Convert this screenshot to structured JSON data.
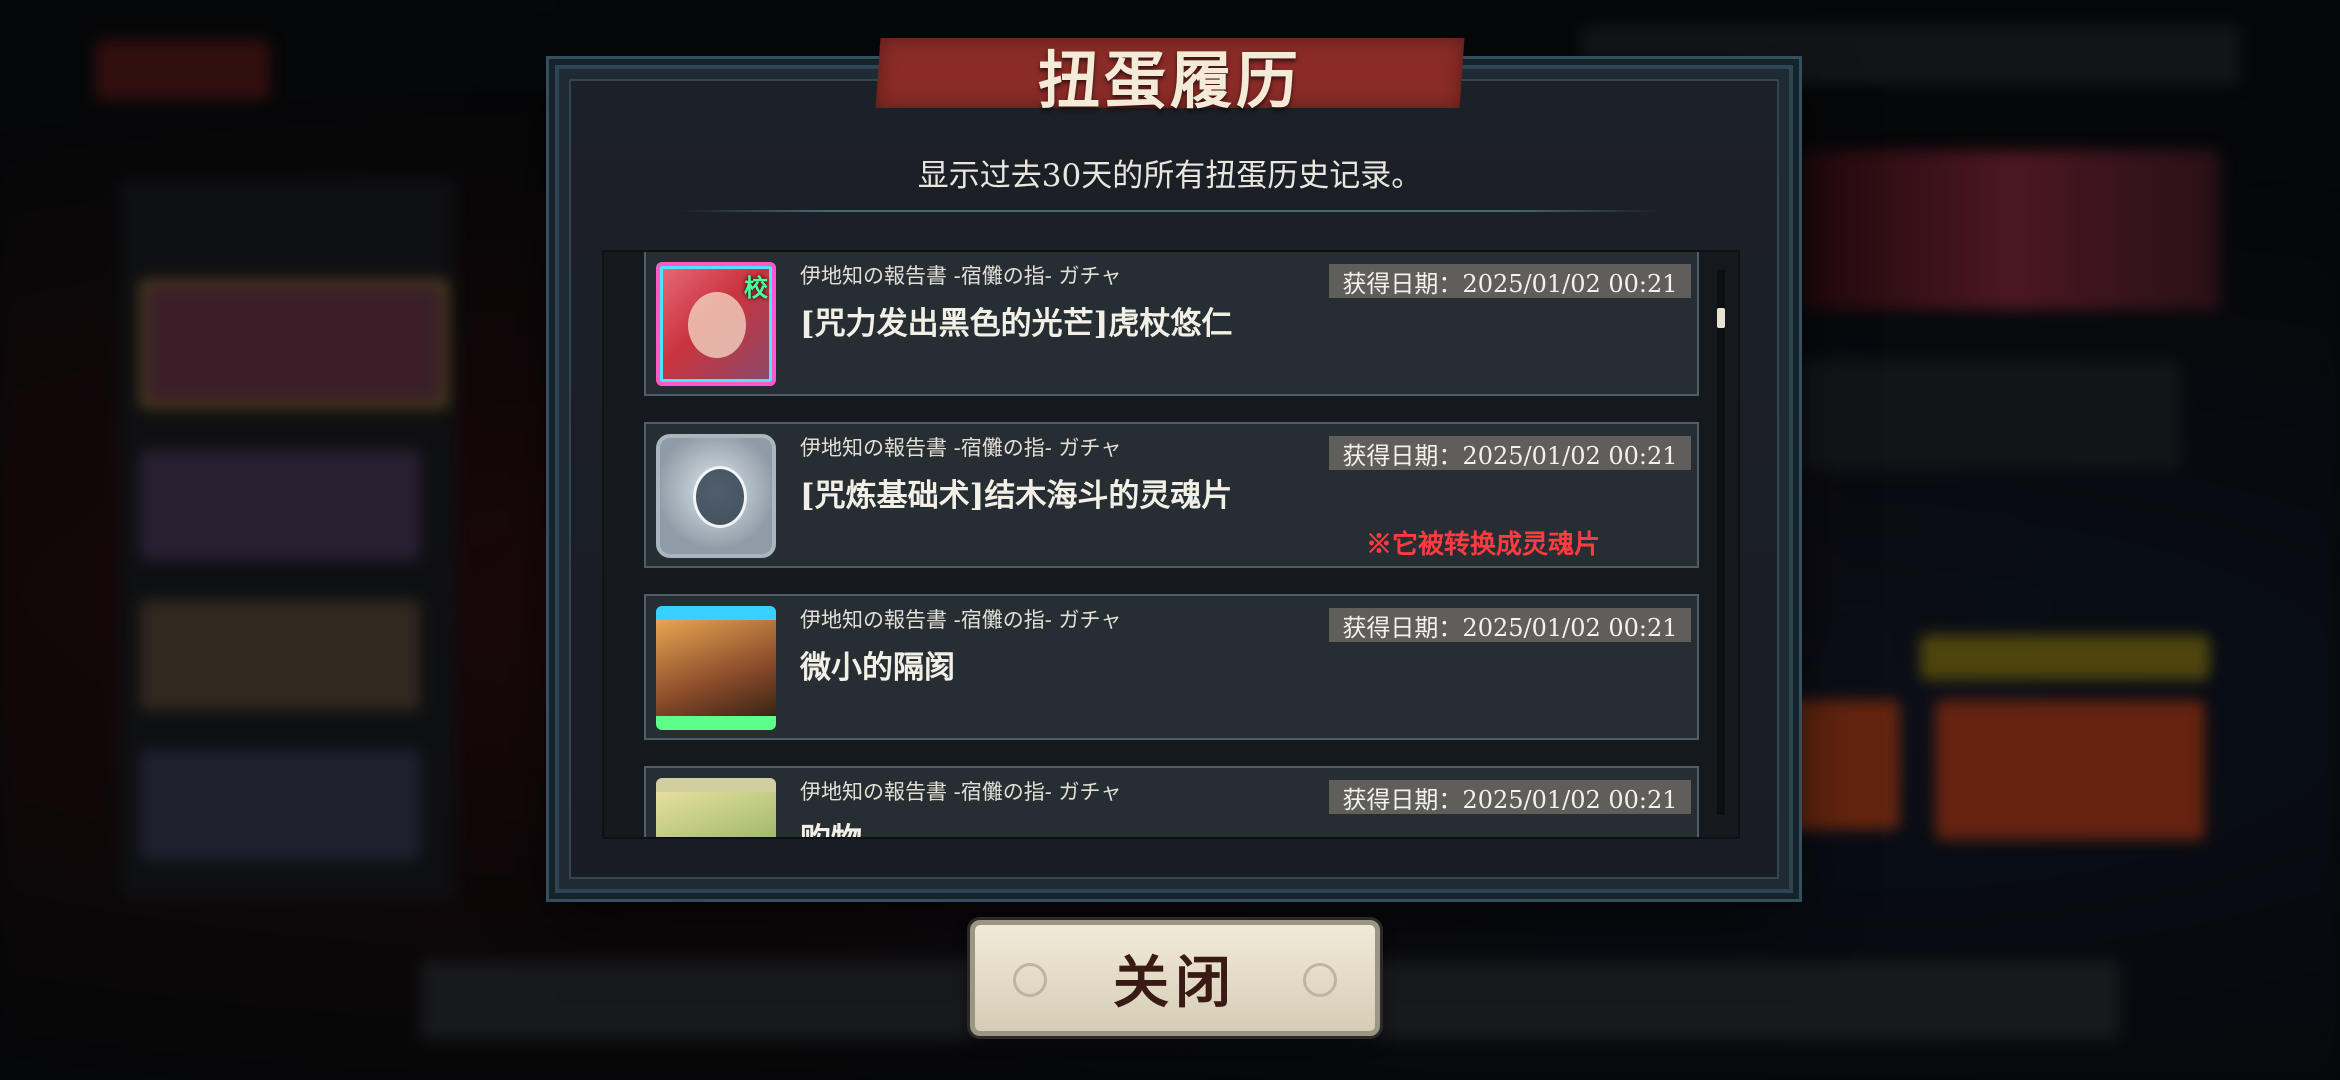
{
  "dialog": {
    "title": "扭蛋履历",
    "subtitle": "显示过去30天的所有扭蛋历史记录。",
    "close_label": "关闭"
  },
  "history": [
    {
      "source": "伊地知の報告書 -宿儺の指- ガチャ",
      "name": "[咒力发出黑色的光芒]虎杖悠仁",
      "date": "获得日期：2025/01/02 00:21",
      "grade": "校",
      "note": ""
    },
    {
      "source": "伊地知の報告書 -宿儺の指- ガチャ",
      "name": "[咒炼基础术]结木海斗的灵魂片",
      "date": "获得日期：2025/01/02 00:21",
      "grade": "",
      "note": "※它被转换成灵魂片"
    },
    {
      "source": "伊地知の報告書 -宿儺の指- ガチャ",
      "name": "微小的隔阂",
      "date": "获得日期：2025/01/02 00:21",
      "grade": "",
      "note": ""
    },
    {
      "source": "伊地知の報告書 -宿儺の指- ガチャ",
      "name": "购物",
      "date": "获得日期：2025/01/02 00:21",
      "grade": "",
      "note": ""
    }
  ],
  "colors": {
    "banner": "#8a2b27",
    "note_red": "#ff3b40",
    "date_badge": "#5f5e5a"
  }
}
